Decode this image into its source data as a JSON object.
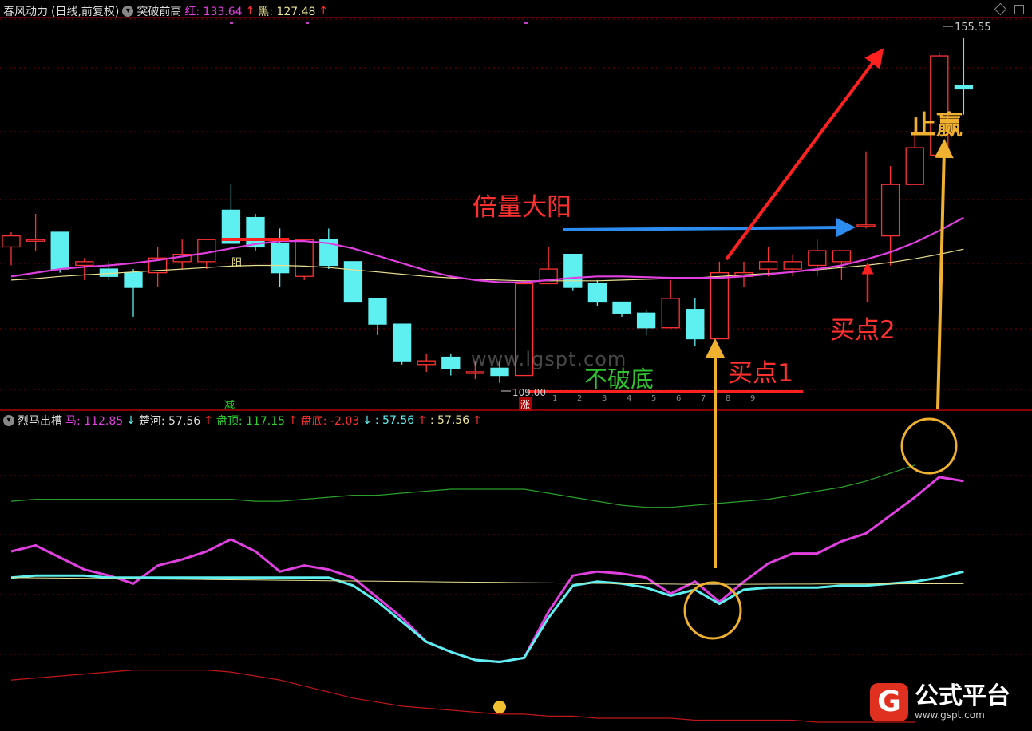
{
  "colors": {
    "up": "#ff3333",
    "down": "#5ef0f0",
    "ma_fast": "#e040e0",
    "ma_slow": "#e8e090",
    "grid": "#7a0000",
    "arrow_red": "#ff2020",
    "arrow_blue": "#2d8cf0",
    "arrow_gold": "#f0b030",
    "green": "#30d030",
    "logo": "#e03020"
  },
  "header_top": {
    "indicator_name": "春风动力",
    "mode": "(日线,前复权)",
    "formula": "突破前高",
    "red_label": "红: 133.64",
    "red_arrow": "↑",
    "black_label": "黑: 127.48",
    "black_arrow": "↑"
  },
  "header_bottom": {
    "indicator_name": "烈马出槽",
    "ma_label": "马: 112.85",
    "ma_arrow": "↓",
    "chuhe_label": "楚河: 57.56",
    "chuhe_arrow": "↑",
    "top_label": "盘顶: 117.15",
    "top_arrow": "↑",
    "bottom_label": "盘底: -2.03",
    "bottom_arrow": "↓",
    "x1_label": ": 57.56",
    "x1_arrow": "↑",
    "x2_label": ": 57.56",
    "x2_arrow": "↑"
  },
  "annotations": {
    "double_volume": "倍量大阳",
    "no_break": "不破底",
    "buy1": "买点1",
    "buy2": "买点2",
    "take_profit": "止赢",
    "yang": "阳",
    "jian": "减",
    "zhang": "涨",
    "high_price": "155.55",
    "low_price": "109.00",
    "day_counts": [
      "1",
      "2",
      "3",
      "4",
      "5",
      "6",
      "7",
      "8",
      "9"
    ]
  },
  "watermark": "www.lgspt.com",
  "logo": {
    "glyph": "G",
    "name": "公式平台",
    "url": "www.gspt.com"
  },
  "chart_data": [
    {
      "type": "candlestick",
      "title": "突破前高",
      "y_unit": "price",
      "ylim": [
        105,
        158
      ],
      "candles": [
        {
          "o": 127.0,
          "h": 129.0,
          "l": 124.5,
          "c": 128.5
        },
        {
          "o": 128.0,
          "h": 131.5,
          "l": 126.5,
          "c": 128.0
        },
        {
          "o": 129.0,
          "h": 129.0,
          "l": 123.5,
          "c": 124.0
        },
        {
          "o": 124.5,
          "h": 125.5,
          "l": 122.5,
          "c": 125.0
        },
        {
          "o": 124.0,
          "h": 125.0,
          "l": 122.5,
          "c": 123.0
        },
        {
          "o": 123.5,
          "h": 124.0,
          "l": 117.5,
          "c": 121.5
        },
        {
          "o": 123.5,
          "h": 127.0,
          "l": 121.5,
          "c": 125.5
        },
        {
          "o": 125.0,
          "h": 128.0,
          "l": 124.0,
          "c": 126.0
        },
        {
          "o": 125.0,
          "h": 128.0,
          "l": 124.0,
          "c": 128.0
        },
        {
          "o": 132.0,
          "h": 135.5,
          "l": 127.5,
          "c": 127.5
        },
        {
          "o": 131.0,
          "h": 131.5,
          "l": 126.5,
          "c": 127.0
        },
        {
          "o": 127.5,
          "h": 129.5,
          "l": 121.5,
          "c": 123.5
        },
        {
          "o": 123.0,
          "h": 128.0,
          "l": 122.5,
          "c": 128.0
        },
        {
          "o": 128.0,
          "h": 129.5,
          "l": 124.0,
          "c": 124.5
        },
        {
          "o": 125.0,
          "h": 125.0,
          "l": 119.5,
          "c": 119.5
        },
        {
          "o": 120.0,
          "h": 120.0,
          "l": 115.0,
          "c": 116.5
        },
        {
          "o": 116.5,
          "h": 116.5,
          "l": 111.0,
          "c": 111.5
        },
        {
          "o": 111.0,
          "h": 112.5,
          "l": 110.0,
          "c": 111.5
        },
        {
          "o": 112.0,
          "h": 112.5,
          "l": 109.5,
          "c": 110.5
        },
        {
          "o": 110.0,
          "h": 111.5,
          "l": 109.0,
          "c": 110.0
        },
        {
          "o": 110.5,
          "h": 111.5,
          "l": 108.5,
          "c": 109.5
        },
        {
          "o": 109.5,
          "h": 122.5,
          "l": 109.5,
          "c": 122.0
        },
        {
          "o": 122.0,
          "h": 127.0,
          "l": 122.0,
          "c": 124.0
        },
        {
          "o": 126.0,
          "h": 126.0,
          "l": 121.0,
          "c": 121.5
        },
        {
          "o": 122.0,
          "h": 122.5,
          "l": 119.0,
          "c": 119.5
        },
        {
          "o": 119.5,
          "h": 119.5,
          "l": 117.5,
          "c": 118.0
        },
        {
          "o": 118.0,
          "h": 118.5,
          "l": 115.0,
          "c": 116.0
        },
        {
          "o": 116.0,
          "h": 122.5,
          "l": 116.0,
          "c": 120.0
        },
        {
          "o": 118.5,
          "h": 120.0,
          "l": 113.5,
          "c": 114.5
        },
        {
          "o": 114.5,
          "h": 125.0,
          "l": 114.5,
          "c": 123.5
        },
        {
          "o": 123.0,
          "h": 125.0,
          "l": 121.5,
          "c": 123.5
        },
        {
          "o": 124.0,
          "h": 127.0,
          "l": 123.0,
          "c": 125.0
        },
        {
          "o": 124.0,
          "h": 126.0,
          "l": 123.0,
          "c": 125.0
        },
        {
          "o": 124.5,
          "h": 128.0,
          "l": 123.0,
          "c": 126.5
        },
        {
          "o": 125.0,
          "h": 125.0,
          "l": 122.5,
          "c": 126.5
        },
        {
          "o": 130.0,
          "h": 140.0,
          "l": 129.5,
          "c": 130.0
        },
        {
          "o": 128.5,
          "h": 138.0,
          "l": 124.5,
          "c": 135.5
        },
        {
          "o": 135.5,
          "h": 143.0,
          "l": 135.5,
          "c": 140.5
        },
        {
          "o": 139.5,
          "h": 153.5,
          "l": 139.5,
          "c": 153.0
        },
        {
          "o": 149.0,
          "h": 155.5,
          "l": 145.0,
          "c": 148.5
        }
      ],
      "ma_fast": [
        123.0,
        123.5,
        124.0,
        124.3,
        124.5,
        124.8,
        125.2,
        125.7,
        126.2,
        126.8,
        127.4,
        127.8,
        127.8,
        127.5,
        126.8,
        125.8,
        124.8,
        123.8,
        123.0,
        122.5,
        122.2,
        122.2,
        122.5,
        122.8,
        123.0,
        123.0,
        122.9,
        122.8,
        122.8,
        122.8,
        123.0,
        123.3,
        123.6,
        124.0,
        124.5,
        125.3,
        126.3,
        127.6,
        129.2,
        131.0
      ],
      "ma_slow": [
        122.5,
        122.7,
        123.0,
        123.2,
        123.4,
        123.6,
        123.8,
        124.0,
        124.2,
        124.4,
        124.5,
        124.5,
        124.4,
        124.2,
        123.9,
        123.6,
        123.3,
        123.0,
        122.8,
        122.6,
        122.5,
        122.4,
        122.4,
        122.4,
        122.4,
        122.5,
        122.6,
        122.7,
        122.8,
        123.0,
        123.2,
        123.4,
        123.6,
        123.9,
        124.2,
        124.5,
        124.9,
        125.4,
        126.0,
        126.7
      ],
      "marked_high": 155.55,
      "marked_low": 109.0
    },
    {
      "type": "line",
      "title": "烈马出槽",
      "ylim": [
        -10,
        135
      ],
      "series": [
        {
          "name": "马",
          "values": [
            75,
            78,
            72,
            66,
            63,
            59,
            68,
            71,
            75,
            81,
            75,
            65,
            68,
            66,
            62,
            52,
            42,
            30,
            25,
            21,
            20,
            22,
            45,
            63,
            65,
            64,
            62,
            54,
            60,
            50,
            60,
            69,
            74,
            74,
            80,
            84,
            93,
            102,
            112,
            110
          ]
        },
        {
          "name": "楚河",
          "values": [
            62,
            63,
            63,
            63,
            62,
            62,
            62,
            62,
            62,
            62,
            62,
            62,
            62,
            62,
            58,
            50,
            40,
            30,
            25,
            21,
            20,
            22,
            42,
            58,
            60,
            59,
            57,
            53,
            56,
            49,
            56,
            57,
            57,
            57,
            58,
            58,
            59,
            60,
            62,
            65
          ]
        },
        {
          "name": "盘顶",
          "values": [
            100,
            101,
            101,
            101,
            101,
            101,
            101,
            101,
            101,
            101,
            100,
            100,
            101,
            102,
            103,
            103,
            104,
            105,
            106,
            106,
            106,
            106,
            104,
            102,
            100,
            98,
            97,
            97,
            98,
            99,
            100,
            101,
            103,
            105,
            107,
            110,
            114,
            118
          ]
        },
        {
          "name": "盘底",
          "values": [
            11,
            12,
            13,
            14,
            15,
            16,
            16,
            16,
            16,
            15,
            13,
            11,
            8,
            5,
            2,
            0,
            -2,
            -3,
            -4,
            -5,
            -6,
            -6,
            -7,
            -7,
            -8,
            -8,
            -8,
            -8,
            -9,
            -9,
            -9,
            -9,
            -9,
            -10,
            -10,
            -10,
            -10,
            -10
          ]
        }
      ]
    }
  ]
}
